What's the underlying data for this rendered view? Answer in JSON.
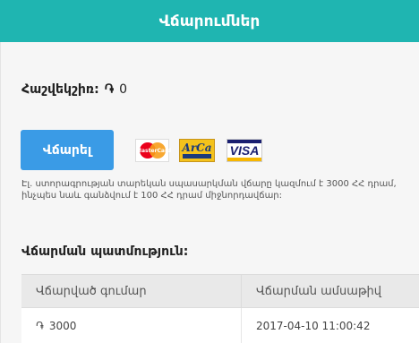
{
  "header": {
    "title": "Վճարումներ"
  },
  "balance": {
    "label": "Հաշվեկշիռ:",
    "currency_symbol": "֏",
    "amount": "0"
  },
  "payment": {
    "button_label": "Վճարել",
    "cards": [
      {
        "name": "mastercard-icon",
        "text": "MasterCard"
      },
      {
        "name": "arca-icon",
        "text": "ArCa"
      },
      {
        "name": "visa-icon",
        "text": "VISA"
      }
    ],
    "note_line1": "Էլ. ստորագրության տարեկան սպասարկման վճարը կազմում է 3000 ՀՀ դրամ,",
    "note_line2": "ինչպես նաև գանձվում է 100 ՀՀ դրամ միջնորդավճար:"
  },
  "history": {
    "title": "Վճարման պատմություն:",
    "columns": [
      "Վճարված գումար",
      "Վճարման ամսաթիվ"
    ],
    "rows": [
      {
        "currency_symbol": "֏",
        "amount": "3000",
        "date": "2017-04-10 11:00:42"
      }
    ]
  },
  "colors": {
    "header": "#1fb5b1",
    "button": "#3a9be6"
  }
}
